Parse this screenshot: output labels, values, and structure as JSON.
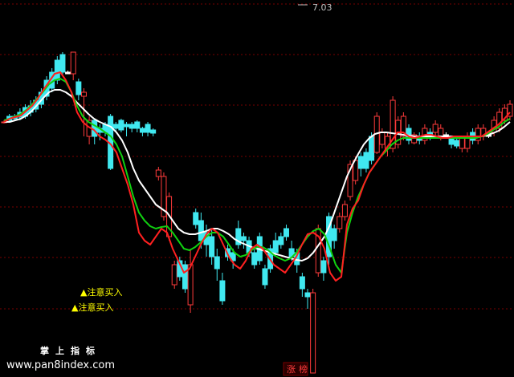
{
  "chart_data": {
    "type": "candlestick",
    "peak_label": "7.03",
    "candles": [
      [
        318,
        318,
        316,
        320,
        "up"
      ],
      [
        320,
        325,
        318,
        328,
        "down"
      ],
      [
        322,
        325,
        320,
        328,
        "down"
      ],
      [
        324,
        330,
        320,
        335,
        "down"
      ],
      [
        325,
        336,
        322,
        340,
        "down"
      ],
      [
        330,
        338,
        325,
        345,
        "down"
      ],
      [
        334,
        345,
        330,
        350,
        "down"
      ],
      [
        340,
        355,
        335,
        360,
        "down"
      ],
      [
        350,
        370,
        345,
        375,
        "down"
      ],
      [
        360,
        380,
        355,
        385,
        "down"
      ],
      [
        370,
        395,
        365,
        400,
        "down"
      ],
      [
        380,
        402,
        375,
        405,
        "down"
      ],
      [
        380,
        378,
        378,
        382,
        "flat"
      ],
      [
        378,
        405,
        370,
        405,
        "up"
      ],
      [
        352,
        368,
        345,
        372,
        "down"
      ],
      [
        355,
        350,
        300,
        360,
        "up"
      ],
      [
        320,
        300,
        290,
        325,
        "up"
      ],
      [
        300,
        320,
        290,
        322,
        "down"
      ],
      [
        305,
        310,
        295,
        315,
        "down"
      ],
      [
        305,
        315,
        300,
        318,
        "down"
      ],
      [
        260,
        325,
        258,
        328,
        "down"
      ],
      [
        310,
        315,
        305,
        318,
        "down"
      ],
      [
        308,
        320,
        305,
        322,
        "down"
      ],
      [
        312,
        315,
        300,
        318,
        "down"
      ],
      [
        310,
        315,
        305,
        318,
        "down"
      ],
      [
        310,
        318,
        305,
        320,
        "down"
      ],
      [
        305,
        310,
        300,
        312,
        "down"
      ],
      [
        305,
        315,
        300,
        318,
        "down"
      ],
      [
        304,
        308,
        300,
        310,
        "down"
      ],
      [
        258,
        250,
        245,
        262,
        "up"
      ],
      [
        200,
        250,
        195,
        255,
        "up"
      ],
      [
        175,
        225,
        170,
        230,
        "up"
      ],
      [
        115,
        140,
        110,
        145,
        "up"
      ],
      [
        145,
        125,
        120,
        150,
        "down"
      ],
      [
        110,
        140,
        105,
        145,
        "down"
      ],
      [
        90,
        140,
        80,
        160,
        "up"
      ],
      [
        190,
        205,
        185,
        210,
        "down"
      ],
      [
        170,
        195,
        160,
        205,
        "down"
      ],
      [
        165,
        180,
        150,
        190,
        "down"
      ],
      [
        150,
        175,
        140,
        185,
        "down"
      ],
      [
        135,
        150,
        120,
        160,
        "down"
      ],
      [
        95,
        120,
        90,
        130,
        "down"
      ],
      [
        150,
        160,
        145,
        165,
        "down"
      ],
      [
        145,
        155,
        135,
        160,
        "down"
      ],
      [
        165,
        185,
        160,
        195,
        "down"
      ],
      [
        170,
        175,
        160,
        180,
        "down"
      ],
      [
        155,
        170,
        150,
        175,
        "down"
      ],
      [
        140,
        155,
        135,
        160,
        "down"
      ],
      [
        145,
        175,
        140,
        180,
        "down"
      ],
      [
        115,
        135,
        110,
        140,
        "down"
      ],
      [
        135,
        160,
        130,
        165,
        "down"
      ],
      [
        155,
        170,
        150,
        180,
        "down"
      ],
      [
        165,
        175,
        160,
        180,
        "down"
      ],
      [
        175,
        185,
        170,
        190,
        "down"
      ],
      [
        150,
        160,
        145,
        170,
        "down"
      ],
      [
        140,
        155,
        130,
        160,
        "down"
      ],
      [
        110,
        125,
        100,
        130,
        "down"
      ],
      [
        100,
        105,
        85,
        110,
        "down"
      ],
      [
        5,
        105,
        5,
        110,
        "up"
      ],
      [
        130,
        185,
        125,
        190,
        "up"
      ],
      [
        130,
        145,
        120,
        150,
        "down"
      ],
      [
        150,
        200,
        140,
        205,
        "down"
      ],
      [
        170,
        185,
        160,
        190,
        "down"
      ],
      [
        185,
        200,
        180,
        205,
        "up"
      ],
      [
        200,
        215,
        195,
        220,
        "up"
      ],
      [
        225,
        265,
        220,
        270,
        "up"
      ],
      [
        245,
        270,
        240,
        275,
        "up"
      ],
      [
        260,
        275,
        250,
        280,
        "down"
      ],
      [
        260,
        280,
        255,
        285,
        "down"
      ],
      [
        270,
        300,
        265,
        305,
        "down"
      ],
      [
        280,
        325,
        278,
        330,
        "up"
      ],
      [
        290,
        305,
        285,
        310,
        "up"
      ],
      [
        285,
        300,
        275,
        305,
        "up"
      ],
      [
        285,
        345,
        280,
        350,
        "up"
      ],
      [
        290,
        320,
        285,
        325,
        "up"
      ],
      [
        300,
        325,
        295,
        330,
        "up"
      ],
      [
        295,
        310,
        290,
        315,
        "down"
      ],
      [
        292,
        302,
        290,
        305,
        "up"
      ],
      [
        295,
        300,
        290,
        305,
        "down"
      ],
      [
        295,
        310,
        290,
        315,
        "up"
      ],
      [
        300,
        305,
        295,
        310,
        "down"
      ],
      [
        305,
        315,
        300,
        320,
        "up"
      ],
      [
        300,
        310,
        295,
        315,
        "up"
      ],
      [
        300,
        302,
        298,
        305,
        "flat"
      ],
      [
        290,
        298,
        285,
        300,
        "down"
      ],
      [
        288,
        295,
        285,
        298,
        "down"
      ],
      [
        285,
        298,
        280,
        300,
        "up"
      ],
      [
        285,
        300,
        280,
        305,
        "up"
      ],
      [
        295,
        305,
        290,
        310,
        "down"
      ],
      [
        295,
        310,
        290,
        315,
        "up"
      ],
      [
        300,
        310,
        295,
        315,
        "up"
      ],
      [
        300,
        302,
        298,
        305,
        "flat"
      ],
      [
        305,
        320,
        300,
        325,
        "up"
      ],
      [
        310,
        330,
        305,
        335,
        "up"
      ],
      [
        320,
        335,
        315,
        340,
        "up"
      ],
      [
        325,
        340,
        320,
        345,
        "up"
      ]
    ],
    "ma_red": [
      318,
      322,
      324,
      326,
      332,
      338,
      347,
      358,
      368,
      378,
      380,
      370,
      355,
      330,
      318,
      312,
      308,
      300,
      296,
      290,
      280,
      260,
      240,
      215,
      180,
      170,
      165,
      175,
      185,
      180,
      160,
      145,
      130,
      135,
      150,
      165,
      178,
      185,
      180,
      165,
      150,
      140,
      135,
      145,
      160,
      165,
      160,
      150,
      140,
      135,
      130,
      140,
      150,
      165,
      178,
      180,
      175,
      160,
      130,
      120,
      125,
      190,
      210,
      220,
      240,
      255,
      265,
      275,
      285,
      295,
      305,
      305,
      300,
      298,
      300,
      302,
      302,
      300,
      298,
      298,
      300,
      300,
      300,
      300,
      300,
      300,
      305,
      310,
      315,
      322,
      330
    ],
    "ma_green": [
      320,
      322,
      325,
      328,
      333,
      340,
      348,
      356,
      365,
      370,
      372,
      368,
      355,
      338,
      325,
      318,
      314,
      310,
      305,
      300,
      290,
      275,
      250,
      225,
      205,
      195,
      188,
      185,
      187,
      188,
      180,
      170,
      160,
      158,
      162,
      168,
      175,
      180,
      180,
      175,
      165,
      155,
      150,
      152,
      158,
      162,
      162,
      158,
      152,
      148,
      145,
      148,
      155,
      165,
      175,
      182,
      185,
      178,
      160,
      140,
      130,
      180,
      205,
      225,
      240,
      255,
      265,
      275,
      282,
      290,
      295,
      298,
      298,
      298,
      298,
      298,
      298,
      298,
      298,
      298,
      298,
      298,
      298,
      298,
      298,
      300,
      303,
      308,
      312,
      318,
      322
    ],
    "ma_white": [
      318,
      318,
      320,
      322,
      326,
      332,
      340,
      348,
      355,
      358,
      358,
      355,
      350,
      342,
      335,
      328,
      322,
      318,
      315,
      312,
      305,
      295,
      280,
      260,
      245,
      235,
      225,
      215,
      210,
      205,
      195,
      185,
      180,
      178,
      178,
      180,
      182,
      185,
      185,
      182,
      178,
      172,
      168,
      165,
      162,
      160,
      158,
      156,
      154,
      152,
      150,
      148,
      146,
      145,
      148,
      155,
      165,
      175,
      190,
      210,
      230,
      250,
      265,
      278,
      290,
      298,
      303,
      305,
      305,
      304,
      303,
      302,
      301,
      300,
      300,
      300,
      300,
      300,
      300,
      300,
      300,
      300,
      300,
      300,
      300,
      300,
      302,
      304,
      307,
      312,
      318
    ],
    "signals": [
      "▲注意买入",
      "▲注意买入"
    ]
  },
  "footer": {
    "brand": "掌上指标",
    "watermark": "www.pan8index.com",
    "tag": "涨榜"
  },
  "colors": {
    "up": "#ff3b3b",
    "down": "#40e8f0",
    "ma_red": "#ff2020",
    "ma_green": "#10d010",
    "ma_white": "#ffffff",
    "signal": "#ffff00"
  }
}
